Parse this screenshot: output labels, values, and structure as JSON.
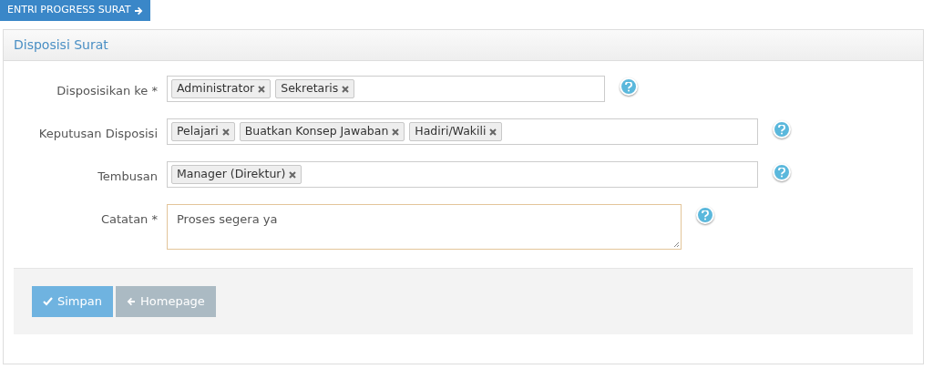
{
  "top_button": {
    "label": "ENTRI PROGRESS SURAT"
  },
  "panel": {
    "title": "Disposisi Surat"
  },
  "fields": [
    {
      "kind": "tags",
      "label": "Disposisikan ke *",
      "tags": [
        "Administrator",
        "Sekretaris"
      ]
    },
    {
      "kind": "tags",
      "label": "Keputusan Disposisi",
      "tags": [
        "Pelajari",
        "Buatkan Konsep Jawaban",
        "Hadiri/Wakili"
      ]
    },
    {
      "kind": "tags",
      "label": "Tembusan",
      "tags": [
        "Manager (Direktur)"
      ]
    },
    {
      "kind": "textarea",
      "label": "Catatan *",
      "value": "Proses segera ya"
    }
  ],
  "actions": [
    {
      "kind": "primary",
      "label": "Simpan"
    },
    {
      "kind": "secondary",
      "label": "Homepage"
    }
  ]
}
